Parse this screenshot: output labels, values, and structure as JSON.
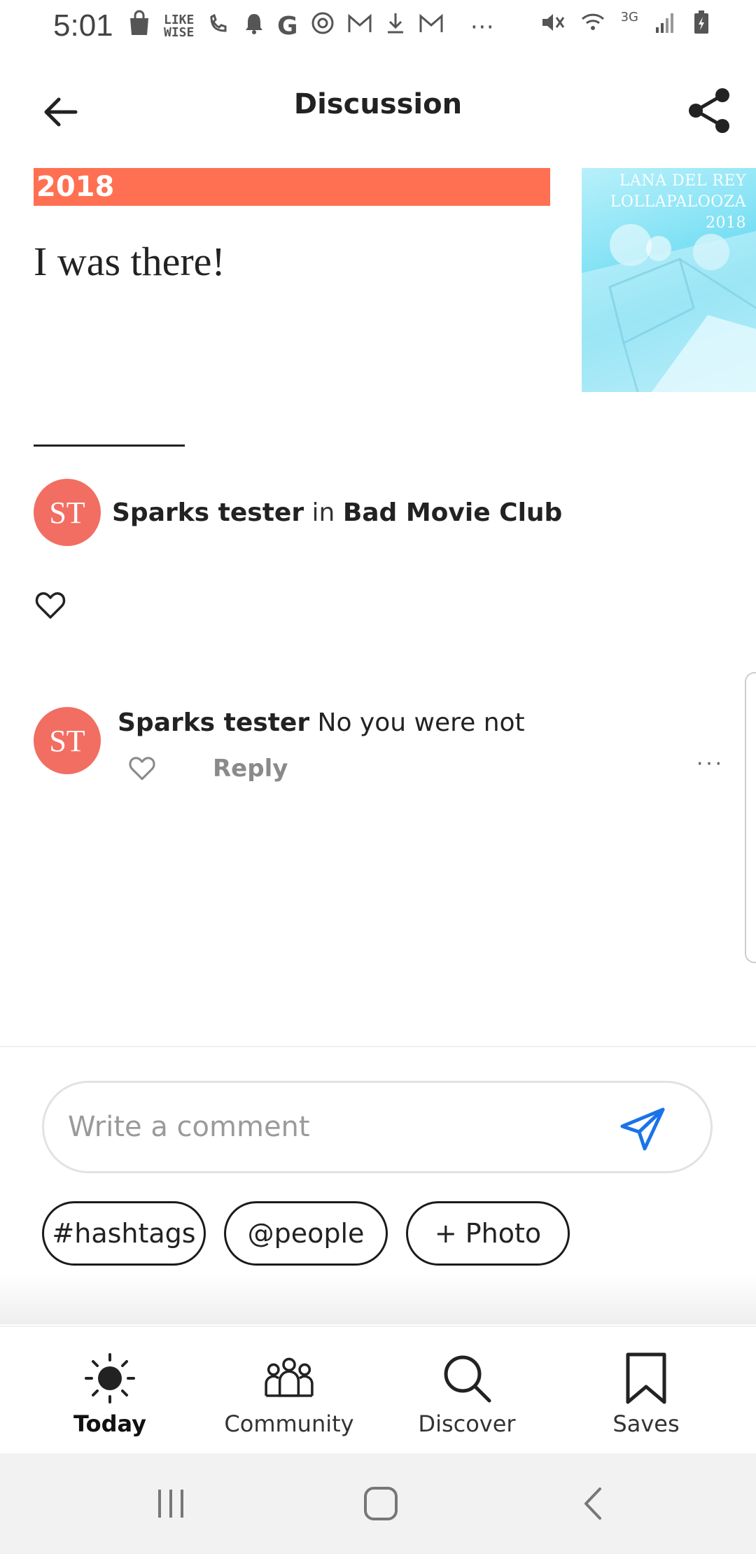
{
  "status_bar": {
    "time": "5:01",
    "left_icons": [
      "shopping-bag-icon",
      "likewise-icon",
      "wifi-calling-icon",
      "bell-icon",
      "google-icon",
      "podcast-icon",
      "gmail-icon",
      "download-icon",
      "gmail-icon",
      "more-dots-icon"
    ],
    "likewise_text": "LIKE WISE",
    "right_icons": [
      "mute-icon",
      "wifi-icon",
      "signal-icon",
      "battery-icon"
    ],
    "network_label": "3G"
  },
  "header": {
    "title": "Discussion",
    "back_icon": "arrow-left-icon",
    "share_icon": "share-icon"
  },
  "post": {
    "banner_text": "2018",
    "thumbnail_text_line1": "LANA DEL REY",
    "thumbnail_text_line2": "LOLLAPALOOZA 2018",
    "body": "I was there!",
    "author_initials": "ST",
    "author_name": "Sparks tester",
    "author_in": "in",
    "group_name": "Bad Movie Club",
    "like_icon": "heart-outline-icon"
  },
  "comments": [
    {
      "initials": "ST",
      "author": "Sparks tester",
      "text": "No you were not",
      "reply_label": "Reply",
      "more_label": "···"
    }
  ],
  "composer": {
    "placeholder": "Write a comment",
    "value": "",
    "send_icon": "send-icon",
    "chips": [
      "#hashtags",
      "@people",
      "+ Photo"
    ]
  },
  "bottom_nav": {
    "items": [
      {
        "label": "Today",
        "icon": "sun-icon",
        "active": true
      },
      {
        "label": "Community",
        "icon": "people-icon",
        "active": false
      },
      {
        "label": "Discover",
        "icon": "search-icon",
        "active": false
      },
      {
        "label": "Saves",
        "icon": "bookmark-icon",
        "active": false
      }
    ]
  },
  "system_nav": {
    "buttons": [
      "recents-icon",
      "home-icon",
      "back-icon"
    ]
  },
  "colors": {
    "accent_orange": "#ff7052",
    "avatar_coral": "#f26e62",
    "send_blue": "#1a73e8",
    "text_dark": "#222222"
  }
}
